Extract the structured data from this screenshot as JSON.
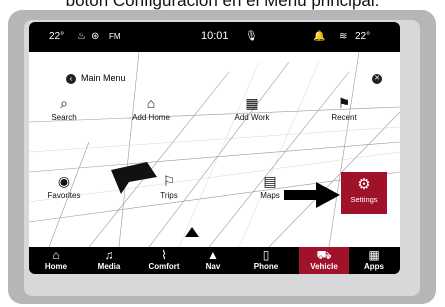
{
  "caption": "botón Configuración en el Menú principal.",
  "status_bar": {
    "left_temp": "22°",
    "fm": "FM",
    "clock": "10:01",
    "right_temp": "22°"
  },
  "menu": {
    "title": "Main Menu",
    "items": [
      {
        "label": "Search",
        "icon": "search-icon"
      },
      {
        "label": "Add Home",
        "icon": "home-plus-icon"
      },
      {
        "label": "Add Work",
        "icon": "building-plus-icon"
      },
      {
        "label": "Recent",
        "icon": "recent-flag-icon"
      },
      {
        "label": "Favorites",
        "icon": "favorites-icon"
      },
      {
        "label": "Trips",
        "icon": "trips-icon"
      },
      {
        "label": "Maps",
        "icon": "maps-icon"
      },
      {
        "label": "Settings",
        "icon": "gear-icon"
      }
    ]
  },
  "bottom_nav": {
    "items": [
      {
        "label": "Home",
        "icon": "home-icon"
      },
      {
        "label": "Media",
        "icon": "music-note-icon"
      },
      {
        "label": "Comfort",
        "icon": "seat-icon"
      },
      {
        "label": "Nav",
        "icon": "navigation-arrow-icon"
      },
      {
        "label": "Phone",
        "icon": "phone-icon"
      },
      {
        "label": "Vehicle",
        "icon": "car-icon"
      },
      {
        "label": "Apps",
        "icon": "grid-icon"
      }
    ],
    "active": "Vehicle"
  },
  "colors": {
    "accent": "#a0122a",
    "bar": "#000000"
  }
}
